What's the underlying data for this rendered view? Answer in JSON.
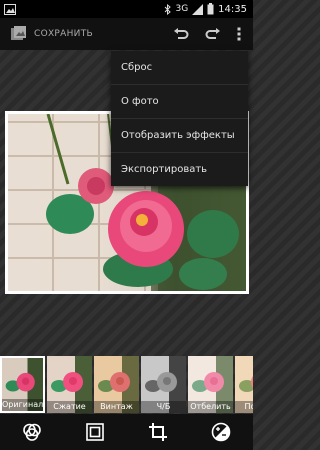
{
  "status_bar": {
    "network": "3G",
    "time": "14:35",
    "icons": [
      "image-icon",
      "bluetooth-icon",
      "signal-icon",
      "battery-icon"
    ]
  },
  "action_bar": {
    "save_label": "СОХРАНИТЬ",
    "icons": [
      "undo-icon",
      "redo-icon",
      "more-vert-icon"
    ]
  },
  "menu": {
    "items": [
      {
        "label": "Сброс"
      },
      {
        "label": "О фото"
      },
      {
        "label": "Отобразить эффекты"
      },
      {
        "label": "Экспортировать"
      }
    ]
  },
  "filmstrip": {
    "items": [
      {
        "label": "Оригинал",
        "selected": true
      },
      {
        "label": "Сжатие"
      },
      {
        "label": "Винтаж"
      },
      {
        "label": "Ч/Б"
      },
      {
        "label": "Отбелить"
      },
      {
        "label": "Поляр"
      }
    ]
  },
  "bottom_bar": {
    "icons": [
      "filters-icon",
      "frame-icon",
      "crop-icon",
      "exposure-icon"
    ]
  },
  "colors": {
    "background": "#2e2e2e",
    "bar": "#111111",
    "menu": "#1b1b1b",
    "rose": "#e0406e",
    "leaf": "#2e8b57"
  }
}
